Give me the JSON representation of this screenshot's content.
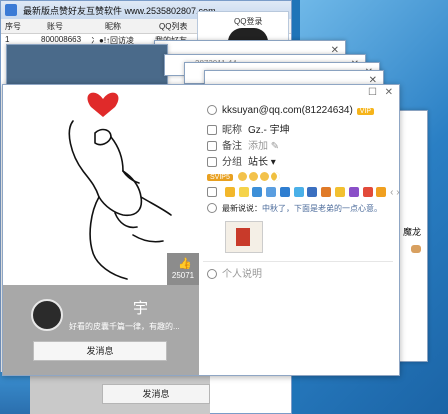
{
  "app": {
    "title": "最新版点赞好友互赞软件 www.2535802807.com",
    "columns": [
      "序号",
      "账号",
      "昵称",
      "QQ列表"
    ],
    "rows": [
      [
        "1",
        "800008663",
        "冫●!↑回访凌",
        "我的好友"
      ]
    ],
    "qq_window_title": "QQ登录"
  },
  "stack": {
    "qq_fragment": "3873011 44"
  },
  "main": {
    "email": "kksuyan@qq.com(81224634)",
    "vip_badge": "VIP",
    "nickname_label": "昵称",
    "nickname": "Gz.- 宇坤",
    "note_label": "备注",
    "note_placeholder": "添加",
    "group_label": "分组",
    "group_value": "站长",
    "level_badge": "SVIP5",
    "news_label": "最新说说：",
    "news_text": "中秋了，下面是老弟的一点心意。",
    "personal_note": "个人说明",
    "likes": "25071",
    "display_name": "宇",
    "signature": "好看的皮囊千篇一律，有趣的...",
    "send_msg": "发消息"
  },
  "behind": {
    "send_msg": "发消息"
  },
  "side": {
    "text": "魔龙"
  },
  "colors": {
    "heart": "#e02a2a",
    "vip": "#f6b41a",
    "desktop": "#1e74b8"
  }
}
